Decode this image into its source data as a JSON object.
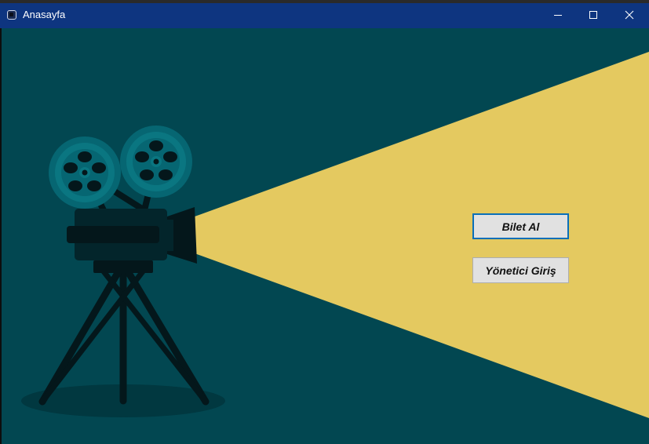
{
  "window": {
    "title": "Anasayfa",
    "controls": {
      "minimize_icon": "minimize-icon",
      "maximize_icon": "maximize-icon",
      "close_icon": "close-icon"
    },
    "titlebar_color": "#0e3580"
  },
  "main": {
    "background_color": "#024751",
    "beam_color": "#e4c960",
    "buttons": {
      "buy_ticket": "Bilet Al",
      "admin_login": "Yönetici Giriş"
    }
  }
}
